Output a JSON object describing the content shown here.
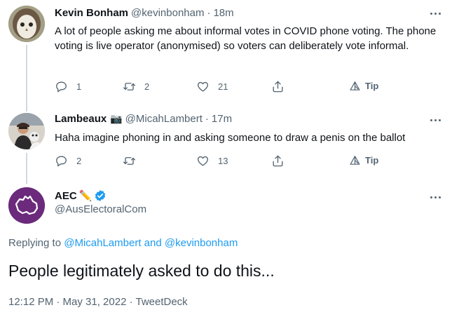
{
  "tweets": [
    {
      "name": "Kevin Bonham",
      "handle": "@kevinbonham",
      "separator": "·",
      "time": "18m",
      "text": "A lot of people asking me about informal votes in COVID phone voting.  The phone voting is live operator (anonymised) so voters can deliberately vote informal.",
      "replies": "1",
      "retweets": "2",
      "likes": "21",
      "tip": "Tip"
    },
    {
      "name": "Lambeaux",
      "name_emoji": "📷",
      "handle": "@MicahLambert",
      "separator": "·",
      "time": "17m",
      "text": "Haha imagine phoning in and asking someone to draw a penis on the ballot",
      "replies": "2",
      "retweets": "",
      "likes": "13",
      "tip": "Tip"
    }
  ],
  "focus": {
    "name": "AEC",
    "name_emoji": "✏️",
    "handle": "@AusElectoralCom",
    "replying_prefix": "Replying to",
    "replying_user1": "@MicahLambert",
    "replying_and": "and",
    "replying_user2": "@kevinbonham",
    "text": "People legitimately asked to do this...",
    "meta": "12:12 PM · May 31, 2022 · TweetDeck"
  },
  "colors": {
    "link": "#1d9bf0",
    "verified": "#1d9bf0",
    "aec_purple": "#6b2a7c"
  },
  "icons": [
    "reply-icon",
    "retweet-icon",
    "like-icon",
    "share-icon",
    "tip-icon",
    "more-icon",
    "verified-badge-icon"
  ]
}
